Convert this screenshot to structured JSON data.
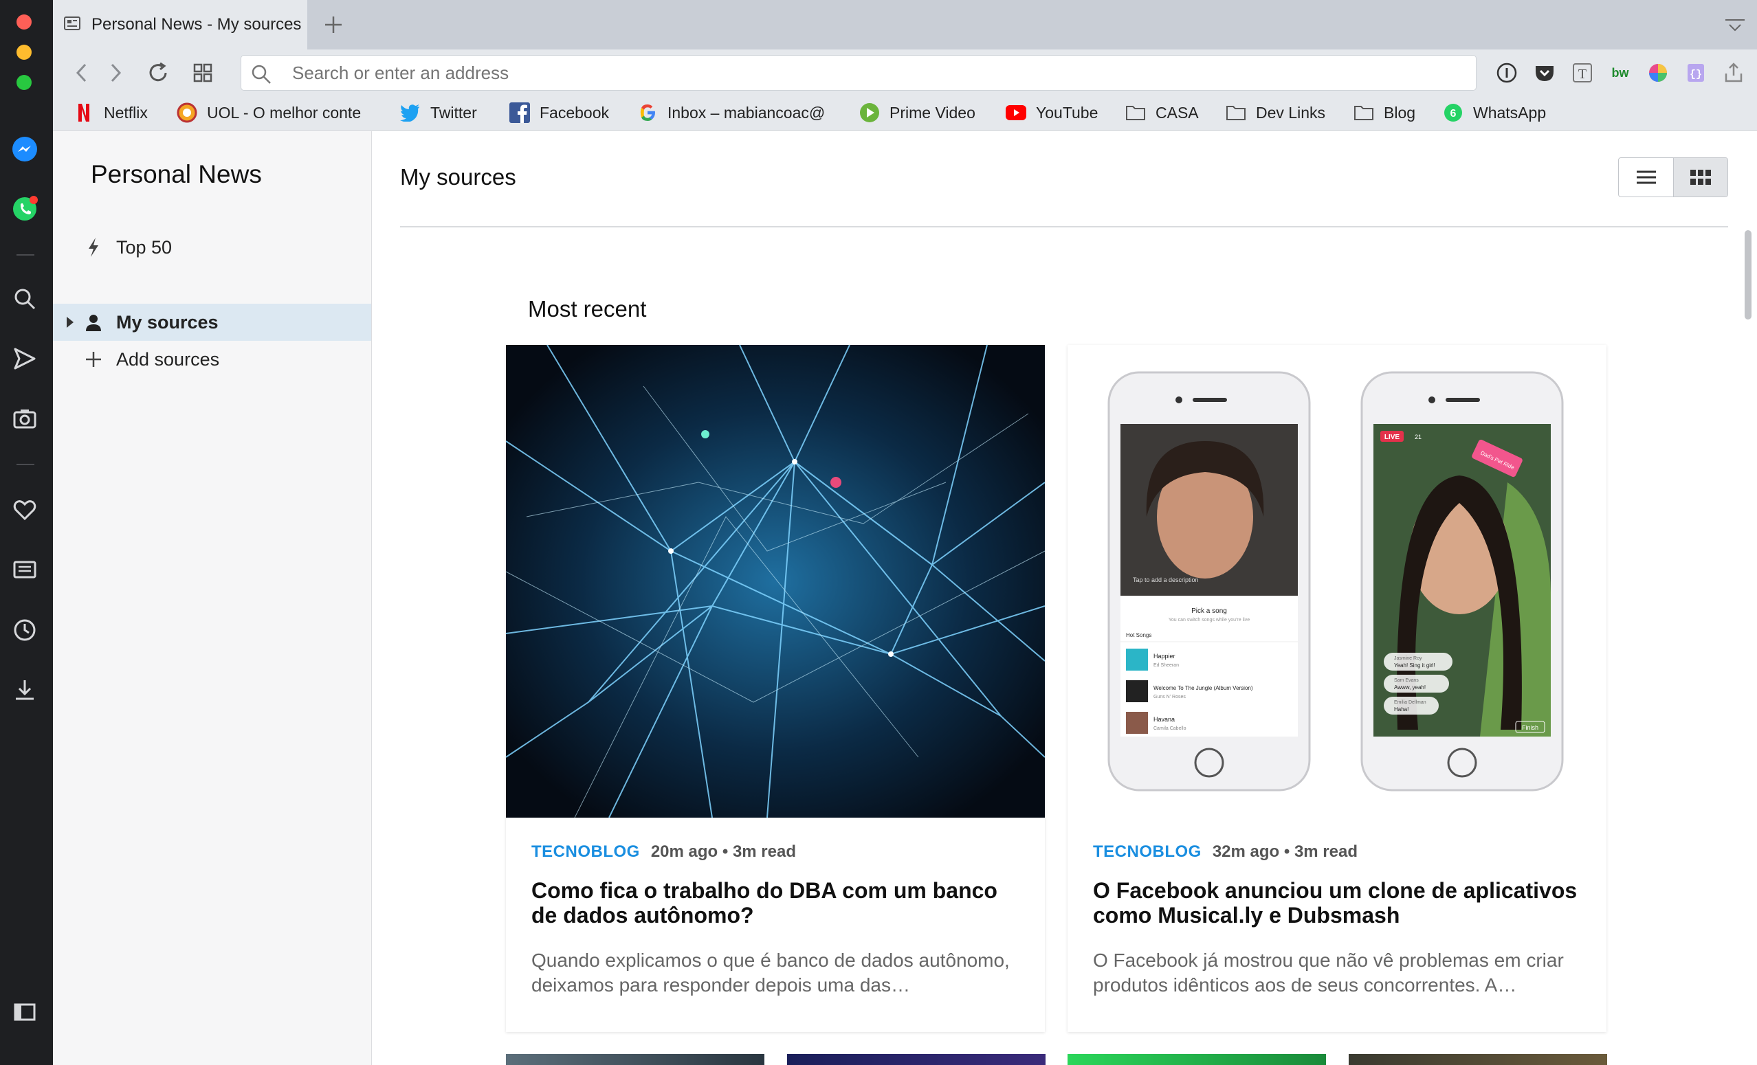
{
  "window": {
    "traffic_lights": [
      "#ff5f57",
      "#febc2e",
      "#28c840"
    ]
  },
  "opera_sidebar": {
    "items": [
      "messenger-icon",
      "whatsapp-icon",
      "search-icon",
      "send-icon",
      "camera-icon",
      "heart-icon",
      "news-icon",
      "history-icon",
      "download-icon",
      "sidebar-toggle-icon"
    ]
  },
  "tab": {
    "title": "Personal News - My sources"
  },
  "address_bar": {
    "placeholder": "Search or enter an address"
  },
  "bookmarks": [
    {
      "label": "Netflix",
      "icon": "netflix-icon"
    },
    {
      "label": "UOL - O melhor conte",
      "icon": "uol-icon"
    },
    {
      "label": "Twitter",
      "icon": "twitter-icon"
    },
    {
      "label": "Facebook",
      "icon": "facebook-icon"
    },
    {
      "label": "Inbox – mabiancoac@",
      "icon": "google-icon"
    },
    {
      "label": "Prime Video",
      "icon": "prime-video-icon"
    },
    {
      "label": "YouTube",
      "icon": "youtube-icon"
    },
    {
      "label": "CASA",
      "icon": "folder-icon"
    },
    {
      "label": "Dev Links",
      "icon": "folder-icon"
    },
    {
      "label": "Blog",
      "icon": "folder-icon"
    },
    {
      "label": "WhatsApp",
      "icon": "whatsapp-icon",
      "badge": "6"
    }
  ],
  "news_nav": {
    "title": "Personal News",
    "top50": "Top 50",
    "my_sources": "My sources",
    "add_sources": "Add sources"
  },
  "main": {
    "title": "My sources",
    "section": "Most recent"
  },
  "articles": [
    {
      "source": "TECNOBLOG",
      "time": "20m ago • 3m read",
      "headline": "Como fica o trabalho do DBA com um banco de dados autônomo?",
      "excerpt": "Quando explicamos o que é banco de dados autônomo, deixamos para responder depois uma das…",
      "phone_ui": null
    },
    {
      "source": "TECNOBLOG",
      "time": "32m ago • 3m read",
      "headline": "O Facebook anunciou um clone de aplicativos como Musical.ly e Dubsmash",
      "excerpt": "O Facebook já mostrou que não vê problemas em criar produtos idênticos aos de seus concorrentes. A…",
      "phone_ui": {
        "left_tap_hint": "Tap to add a description",
        "pick_song": "Pick a song",
        "pick_song_sub": "You can switch songs while you're live",
        "hot_songs": "Hot Songs",
        "songs": [
          {
            "title": "Happier",
            "artist": "Ed Sheeran"
          },
          {
            "title": "Welcome To The Jungle (Album Version)",
            "artist": "Guns N' Roses"
          },
          {
            "title": "Havana",
            "artist": "Camila Cabello"
          }
        ],
        "live_badge": "LIVE",
        "live_viewers": "21",
        "sticker_text": "Dad's Pet Ride",
        "comments": [
          {
            "user": "Jasmine Roy",
            "text": "Yeah! Sing it girl!"
          },
          {
            "user": "Sam Evans",
            "text": "Awww, yeah!"
          },
          {
            "user": "Emilia Dellman",
            "text": "Haha!"
          }
        ],
        "finish_label": "Finish"
      }
    }
  ]
}
